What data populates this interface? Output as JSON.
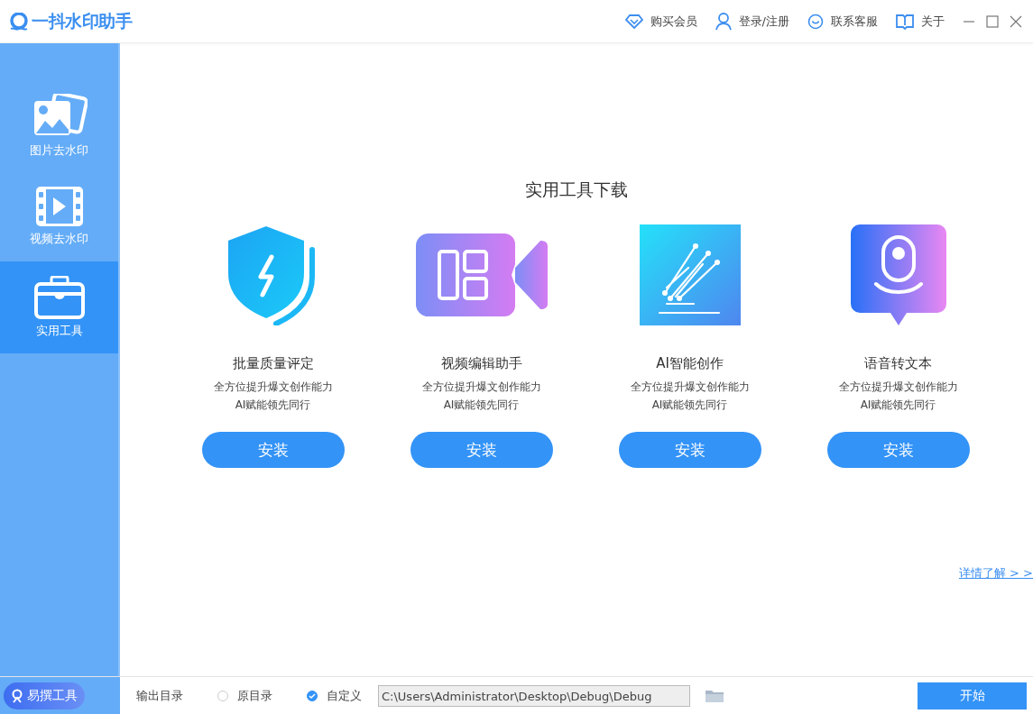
{
  "app": {
    "title": "一抖水印助手"
  },
  "header_links": [
    {
      "kind": "vip",
      "label": "购买会员"
    },
    {
      "kind": "user",
      "label": "登录/注册"
    },
    {
      "kind": "service",
      "label": "联系客服"
    },
    {
      "kind": "about",
      "label": "关于"
    }
  ],
  "sidebar": {
    "items": [
      {
        "kind": "image",
        "label": "图片去水印",
        "selected": false
      },
      {
        "kind": "video",
        "label": "视频去水印",
        "selected": false
      },
      {
        "kind": "tools",
        "label": "实用工具",
        "selected": true
      }
    ],
    "promo": "易撰工具"
  },
  "section_title": "实用工具下载",
  "tools": [
    {
      "kind": "shield",
      "name": "批量质量评定",
      "line1": "全方位提升爆文创作能力",
      "line2": "AI赋能领先同行",
      "button": "安装"
    },
    {
      "kind": "video",
      "name": "视频编辑助手",
      "line1": "全方位提升爆文创作能力",
      "line2": "AI赋能领先同行",
      "button": "安装"
    },
    {
      "kind": "pen",
      "name": "AI智能创作",
      "line1": "全方位提升爆文创作能力",
      "line2": "AI赋能领先同行",
      "button": "安装"
    },
    {
      "kind": "voice",
      "name": "语音转文本",
      "line1": "全方位提升爆文创作能力",
      "line2": "AI赋能领先同行",
      "button": "安装"
    }
  ],
  "more_link": "详情了解 > >",
  "footer": {
    "label": "输出目录",
    "options": [
      {
        "label": "原目录",
        "selected": false
      },
      {
        "label": "自定义",
        "selected": true
      }
    ],
    "path": "C:\\Users\\Administrator\\Desktop\\Debug\\Debug",
    "start": "开始"
  }
}
